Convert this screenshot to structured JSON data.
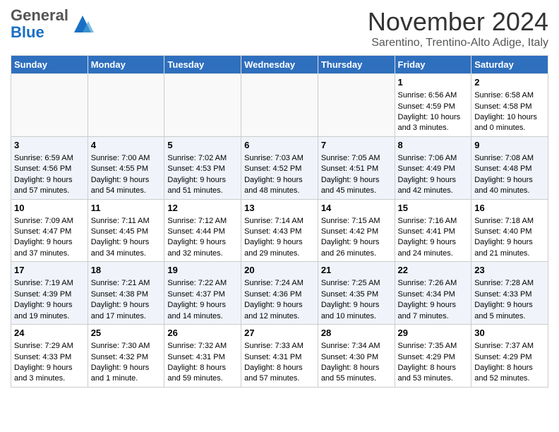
{
  "header": {
    "logo_general": "General",
    "logo_blue": "Blue",
    "month_title": "November 2024",
    "location": "Sarentino, Trentino-Alto Adige, Italy"
  },
  "days_of_week": [
    "Sunday",
    "Monday",
    "Tuesday",
    "Wednesday",
    "Thursday",
    "Friday",
    "Saturday"
  ],
  "weeks": [
    {
      "days": [
        {
          "num": "",
          "info": ""
        },
        {
          "num": "",
          "info": ""
        },
        {
          "num": "",
          "info": ""
        },
        {
          "num": "",
          "info": ""
        },
        {
          "num": "",
          "info": ""
        },
        {
          "num": "1",
          "info": "Sunrise: 6:56 AM\nSunset: 4:59 PM\nDaylight: 10 hours and 3 minutes."
        },
        {
          "num": "2",
          "info": "Sunrise: 6:58 AM\nSunset: 4:58 PM\nDaylight: 10 hours and 0 minutes."
        }
      ]
    },
    {
      "days": [
        {
          "num": "3",
          "info": "Sunrise: 6:59 AM\nSunset: 4:56 PM\nDaylight: 9 hours and 57 minutes."
        },
        {
          "num": "4",
          "info": "Sunrise: 7:00 AM\nSunset: 4:55 PM\nDaylight: 9 hours and 54 minutes."
        },
        {
          "num": "5",
          "info": "Sunrise: 7:02 AM\nSunset: 4:53 PM\nDaylight: 9 hours and 51 minutes."
        },
        {
          "num": "6",
          "info": "Sunrise: 7:03 AM\nSunset: 4:52 PM\nDaylight: 9 hours and 48 minutes."
        },
        {
          "num": "7",
          "info": "Sunrise: 7:05 AM\nSunset: 4:51 PM\nDaylight: 9 hours and 45 minutes."
        },
        {
          "num": "8",
          "info": "Sunrise: 7:06 AM\nSunset: 4:49 PM\nDaylight: 9 hours and 42 minutes."
        },
        {
          "num": "9",
          "info": "Sunrise: 7:08 AM\nSunset: 4:48 PM\nDaylight: 9 hours and 40 minutes."
        }
      ]
    },
    {
      "days": [
        {
          "num": "10",
          "info": "Sunrise: 7:09 AM\nSunset: 4:47 PM\nDaylight: 9 hours and 37 minutes."
        },
        {
          "num": "11",
          "info": "Sunrise: 7:11 AM\nSunset: 4:45 PM\nDaylight: 9 hours and 34 minutes."
        },
        {
          "num": "12",
          "info": "Sunrise: 7:12 AM\nSunset: 4:44 PM\nDaylight: 9 hours and 32 minutes."
        },
        {
          "num": "13",
          "info": "Sunrise: 7:14 AM\nSunset: 4:43 PM\nDaylight: 9 hours and 29 minutes."
        },
        {
          "num": "14",
          "info": "Sunrise: 7:15 AM\nSunset: 4:42 PM\nDaylight: 9 hours and 26 minutes."
        },
        {
          "num": "15",
          "info": "Sunrise: 7:16 AM\nSunset: 4:41 PM\nDaylight: 9 hours and 24 minutes."
        },
        {
          "num": "16",
          "info": "Sunrise: 7:18 AM\nSunset: 4:40 PM\nDaylight: 9 hours and 21 minutes."
        }
      ]
    },
    {
      "days": [
        {
          "num": "17",
          "info": "Sunrise: 7:19 AM\nSunset: 4:39 PM\nDaylight: 9 hours and 19 minutes."
        },
        {
          "num": "18",
          "info": "Sunrise: 7:21 AM\nSunset: 4:38 PM\nDaylight: 9 hours and 17 minutes."
        },
        {
          "num": "19",
          "info": "Sunrise: 7:22 AM\nSunset: 4:37 PM\nDaylight: 9 hours and 14 minutes."
        },
        {
          "num": "20",
          "info": "Sunrise: 7:24 AM\nSunset: 4:36 PM\nDaylight: 9 hours and 12 minutes."
        },
        {
          "num": "21",
          "info": "Sunrise: 7:25 AM\nSunset: 4:35 PM\nDaylight: 9 hours and 10 minutes."
        },
        {
          "num": "22",
          "info": "Sunrise: 7:26 AM\nSunset: 4:34 PM\nDaylight: 9 hours and 7 minutes."
        },
        {
          "num": "23",
          "info": "Sunrise: 7:28 AM\nSunset: 4:33 PM\nDaylight: 9 hours and 5 minutes."
        }
      ]
    },
    {
      "days": [
        {
          "num": "24",
          "info": "Sunrise: 7:29 AM\nSunset: 4:33 PM\nDaylight: 9 hours and 3 minutes."
        },
        {
          "num": "25",
          "info": "Sunrise: 7:30 AM\nSunset: 4:32 PM\nDaylight: 9 hours and 1 minute."
        },
        {
          "num": "26",
          "info": "Sunrise: 7:32 AM\nSunset: 4:31 PM\nDaylight: 8 hours and 59 minutes."
        },
        {
          "num": "27",
          "info": "Sunrise: 7:33 AM\nSunset: 4:31 PM\nDaylight: 8 hours and 57 minutes."
        },
        {
          "num": "28",
          "info": "Sunrise: 7:34 AM\nSunset: 4:30 PM\nDaylight: 8 hours and 55 minutes."
        },
        {
          "num": "29",
          "info": "Sunrise: 7:35 AM\nSunset: 4:29 PM\nDaylight: 8 hours and 53 minutes."
        },
        {
          "num": "30",
          "info": "Sunrise: 7:37 AM\nSunset: 4:29 PM\nDaylight: 8 hours and 52 minutes."
        }
      ]
    }
  ]
}
